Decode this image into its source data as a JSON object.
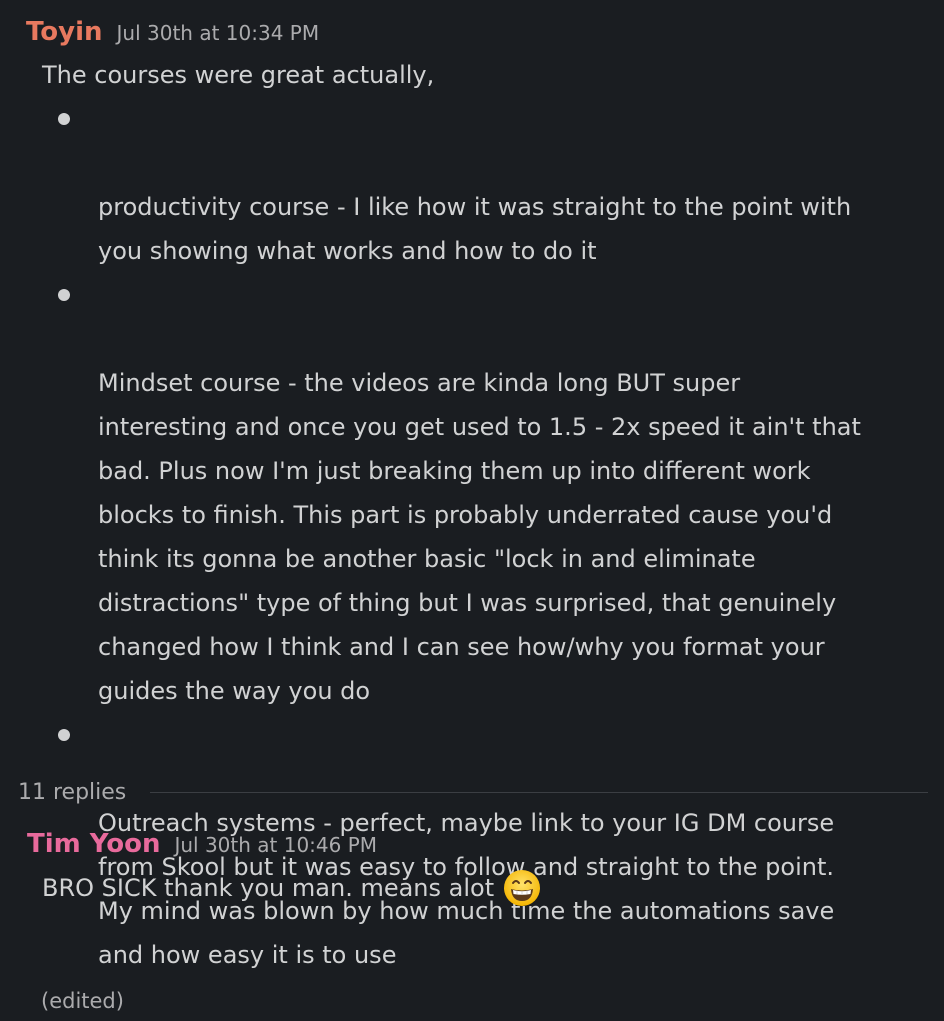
{
  "colors": {
    "background": "#1a1d21",
    "text": "#d1d2d3",
    "muted": "#ababad",
    "author1": "#e8795f",
    "author2": "#e86a9c"
  },
  "messages": [
    {
      "author": "Toyin",
      "timestamp": "Jul 30th at 10:34 PM",
      "intro": "The courses were great actually,",
      "bullets": [
        "productivity course - I like how it was straight to the point with\nyou showing what works and how to do it",
        "Mindset course - the videos are kinda long BUT super\ninteresting and once you get used to 1.5 - 2x speed it ain't that\nbad. Plus now I'm just breaking them up into different work\nblocks to finish. This part is probably underrated cause you'd\nthink its gonna be another basic \"lock in and eliminate\ndistractions\" type of thing but I was surprised, that genuinely\nchanged how I think and I can see how/why you format your\nguides the way you do",
        "Outreach systems - perfect, maybe link to your IG DM course\nfrom Skool but it was easy to follow and straight to the point.\nMy mind was blown by how much time the automations save\nand how easy it is to use"
      ],
      "edited": "(edited)"
    },
    {
      "author": "Tim Yoon",
      "timestamp": "Jul 30th at 10:46 PM",
      "text": "BRO SICK thank you man. means alot",
      "emoji": "grinning-face-icon"
    }
  ],
  "thread": {
    "replies_label": "11 replies"
  }
}
